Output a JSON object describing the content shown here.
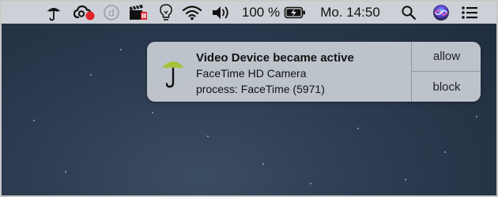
{
  "menubar": {
    "battery_percent": "100 %",
    "clock": "Mo. 14:50",
    "icons": [
      "umbrella-icon",
      "creative-cloud-icon",
      "dash-d-icon",
      "clapperboard-icon",
      "lightbulb-icon",
      "wifi-icon",
      "volume-icon",
      "battery-charging-icon",
      "search-icon",
      "siri-icon",
      "notification-center-icon"
    ],
    "battery_level": 1.0
  },
  "notification": {
    "title": "Video Device became active",
    "subtitle": "FaceTime HD Camera",
    "process": "process: FaceTime (5971)",
    "allow_label": "allow",
    "block_label": "block",
    "icon": "umbrella-icon",
    "icon_color": "#a6c239"
  },
  "colors": {
    "menubar_bg": "#cdd1d7",
    "desktop": "#2c3b50",
    "accent_red": "#e0242b",
    "umbrella_green": "#a6c239"
  }
}
